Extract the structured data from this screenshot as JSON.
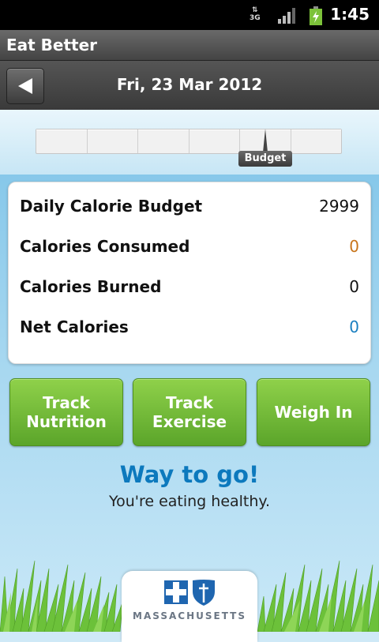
{
  "status_bar": {
    "network": "3G",
    "time": "1:45"
  },
  "app": {
    "title": "Eat Better"
  },
  "date_header": {
    "date": "Fri, 23 Mar 2012"
  },
  "slider": {
    "tag_label": "Budget",
    "segment_count": 6
  },
  "stats": [
    {
      "label": "Daily Calorie Budget",
      "value": "2999",
      "color": "#111111"
    },
    {
      "label": "Calories Consumed",
      "value": "0",
      "color": "#c8741a"
    },
    {
      "label": "Calories Burned",
      "value": "0",
      "color": "#111111"
    },
    {
      "label": "Net Calories",
      "value": "0",
      "color": "#1a7fc0"
    }
  ],
  "buttons": {
    "track_nutrition": "Track\nNutrition",
    "track_exercise": "Track\nExercise",
    "weigh_in": "Weigh In"
  },
  "message": {
    "title": "Way to go!",
    "subtitle": "You're eating healthy."
  },
  "logo": {
    "text": "MASSACHUSETTS"
  },
  "colors": {
    "accent_blue": "#0c79bd",
    "button_green": "#6fb936"
  }
}
